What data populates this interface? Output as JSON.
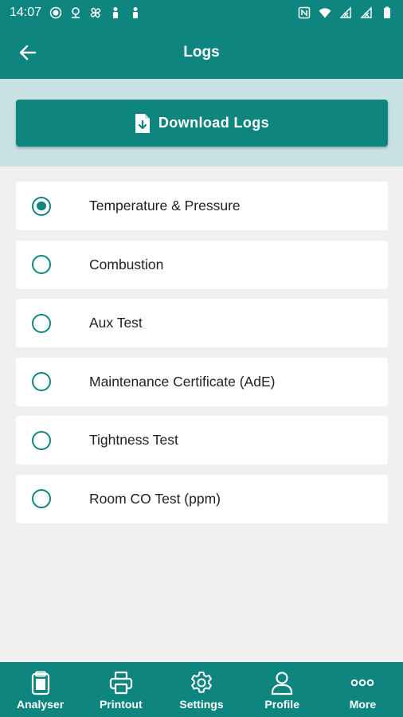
{
  "status_bar": {
    "time": "14:07",
    "left_icons": [
      "record-icon",
      "location-icon",
      "fan-icon",
      "person-icon",
      "person-icon"
    ],
    "right_icons": [
      "nfc-icon",
      "wifi-icon",
      "no-signal-icon",
      "no-signal-icon",
      "battery-icon"
    ]
  },
  "app_bar": {
    "title": "Logs",
    "back_icon": "arrow-left-icon"
  },
  "download": {
    "label": "Download Logs",
    "icon": "file-download-icon"
  },
  "logs": {
    "items": [
      {
        "label": "Temperature & Pressure",
        "selected": true
      },
      {
        "label": "Combustion",
        "selected": false
      },
      {
        "label": "Aux Test",
        "selected": false
      },
      {
        "label": "Maintenance Certificate (AdE)",
        "selected": false
      },
      {
        "label": "Tightness Test",
        "selected": false
      },
      {
        "label": "Room CO Test (ppm)",
        "selected": false
      }
    ]
  },
  "bottom_nav": {
    "items": [
      {
        "label": "Analyser",
        "icon": "clipboard-icon"
      },
      {
        "label": "Printout",
        "icon": "printer-icon"
      },
      {
        "label": "Settings",
        "icon": "gear-icon"
      },
      {
        "label": "Profile",
        "icon": "user-icon"
      },
      {
        "label": "More",
        "icon": "more-dots-icon"
      }
    ]
  },
  "colors": {
    "primary": "#0e857f",
    "banner": "#c8e2e3",
    "background": "#f0f0f0"
  }
}
